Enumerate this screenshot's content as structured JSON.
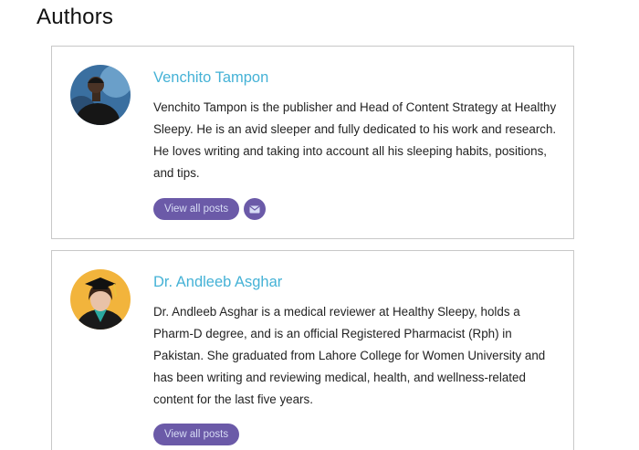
{
  "page": {
    "section_title": "Authors"
  },
  "authors": [
    {
      "name": "Venchito Tampon",
      "bio": "Venchito Tampon is the publisher and Head of Content Strategy at Healthy Sleepy. He is an avid sleeper and fully dedicated to his work and research. He loves writing and taking into account all his sleeping habits, positions, and tips.",
      "view_posts_label": "View all posts",
      "email_icon": "envelope-icon"
    },
    {
      "name": "Dr. Andleeb Asghar",
      "bio": "Dr. Andleeb Asghar is a medical reviewer at Healthy Sleepy, holds a Pharm-D degree, and is an official Registered Pharmacist (Rph) in Pakistan. She graduated from Lahore College for Women University and has been writing and reviewing medical, health, and wellness-related content for the last five years.",
      "view_posts_label": "View all posts"
    }
  ],
  "colors": {
    "name_link": "#45b2d6",
    "button": "#6b5aa8",
    "button_text": "#d7dcf5",
    "card_border": "#c8c8c8"
  }
}
